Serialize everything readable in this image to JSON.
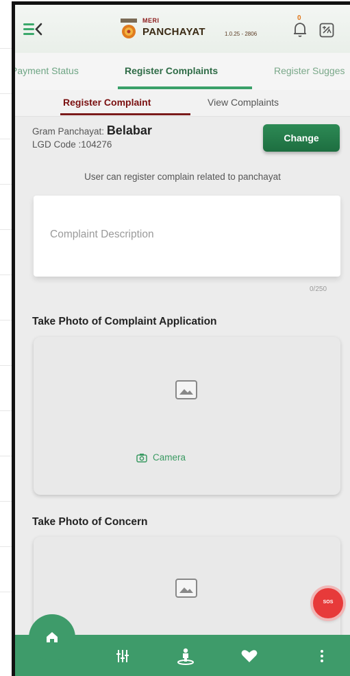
{
  "header": {
    "brand_small": "MERI",
    "brand_name": "PANCHAYAT",
    "version": "1.0.25 - 2806",
    "notification_count": "0"
  },
  "top_tabs": [
    "Payment Status",
    "Register Complaints",
    "Register Sugges"
  ],
  "sub_tabs": [
    "Register Complaint",
    "View Complaints"
  ],
  "panchayat": {
    "label": "Gram Panchayat:",
    "name": "Belabar",
    "lgd": "LGD Code :104276",
    "change_label": "Change"
  },
  "helper_text": "User can register complain related to panchayat",
  "complaint": {
    "placeholder": "Complaint Description",
    "counter": "0/250"
  },
  "section_application": "Take Photo of Complaint Application",
  "camera_label": "Camera",
  "section_concern": "Take Photo of Concern",
  "sos_label": "SOS",
  "colors": {
    "primary_green": "#3e9b6a",
    "button_green": "#1d6e40",
    "active_subtab": "#7a1a1a",
    "sos_red": "#e73a3a"
  },
  "nav_icons": [
    "home-icon",
    "filter-icon",
    "person-location-icon",
    "heart-icon",
    "more-vertical-icon"
  ]
}
